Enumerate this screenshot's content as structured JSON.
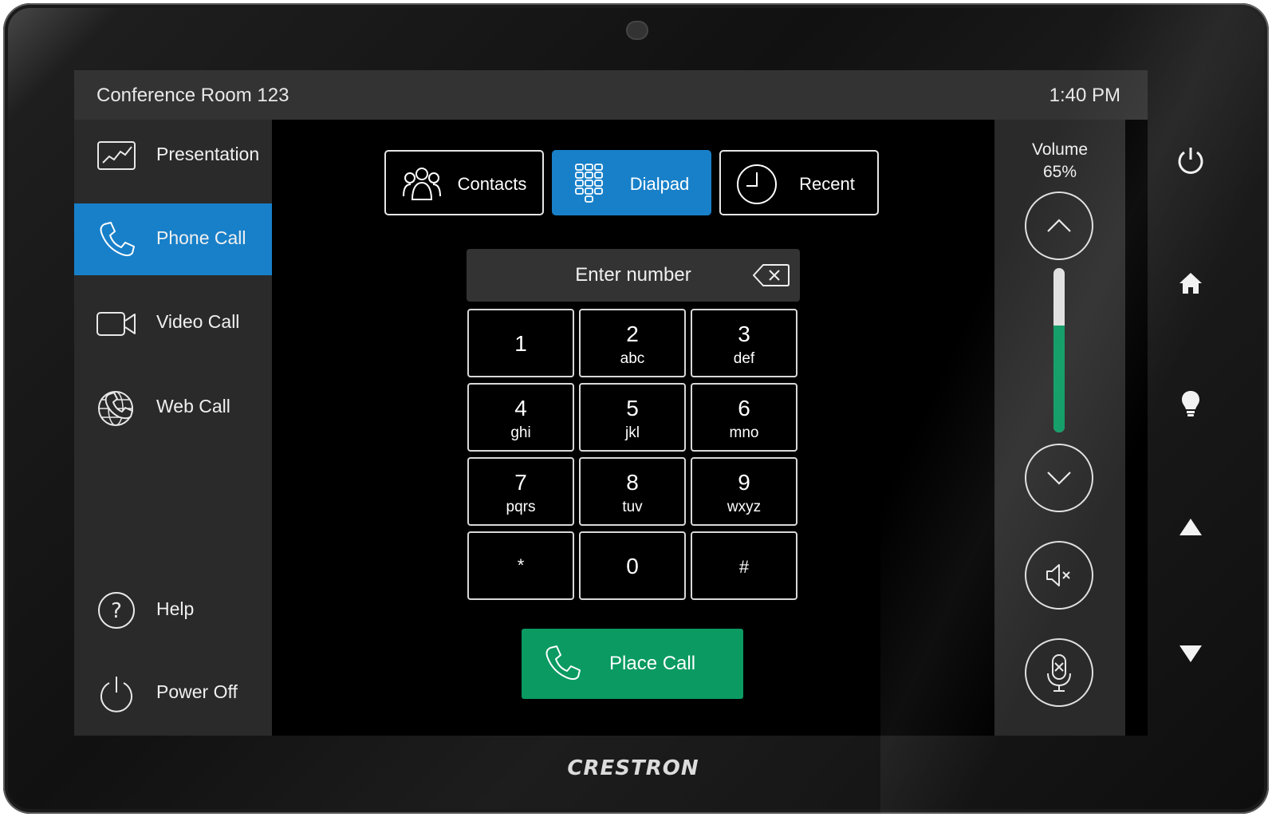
{
  "header": {
    "room_name": "Conference Room 123",
    "time": "1:40 PM"
  },
  "sidebar": {
    "items": [
      {
        "label": "Presentation",
        "icon": "presentation-chart-icon",
        "active": false
      },
      {
        "label": "Phone Call",
        "icon": "phone-icon",
        "active": true
      },
      {
        "label": "Video Call",
        "icon": "video-camera-icon",
        "active": false
      },
      {
        "label": "Web Call",
        "icon": "globe-phone-icon",
        "active": false
      }
    ],
    "bottom_items": [
      {
        "label": "Help",
        "icon": "help-icon"
      },
      {
        "label": "Power Off",
        "icon": "power-icon"
      }
    ]
  },
  "tabs": [
    {
      "label": "Contacts",
      "icon": "contacts-icon",
      "active": false
    },
    {
      "label": "Dialpad",
      "icon": "dialpad-icon",
      "active": true
    },
    {
      "label": "Recent",
      "icon": "clock-icon",
      "active": false
    }
  ],
  "dialpad": {
    "number_placeholder": "Enter number",
    "keys": [
      {
        "digit": "1",
        "letters": ""
      },
      {
        "digit": "2",
        "letters": "abc"
      },
      {
        "digit": "3",
        "letters": "def"
      },
      {
        "digit": "4",
        "letters": "ghi"
      },
      {
        "digit": "5",
        "letters": "jkl"
      },
      {
        "digit": "6",
        "letters": "mno"
      },
      {
        "digit": "7",
        "letters": "pqrs"
      },
      {
        "digit": "8",
        "letters": "tuv"
      },
      {
        "digit": "9",
        "letters": "wxyz"
      },
      {
        "digit": "*",
        "letters": ""
      },
      {
        "digit": "0",
        "letters": ""
      },
      {
        "digit": "#",
        "letters": ""
      }
    ],
    "place_call_label": "Place Call"
  },
  "volume": {
    "title": "Volume",
    "level_text": "65%",
    "level": 0.65
  },
  "hardware_buttons": [
    "power-icon",
    "home-icon",
    "lightbulb-icon",
    "triangle-up-icon",
    "triangle-down-icon"
  ],
  "brand": "CRESTRON",
  "colors": {
    "accent_blue": "#1880c9",
    "call_green": "#0a9a62",
    "panel_gray": "#2a2a2a",
    "header_gray": "#333333"
  }
}
